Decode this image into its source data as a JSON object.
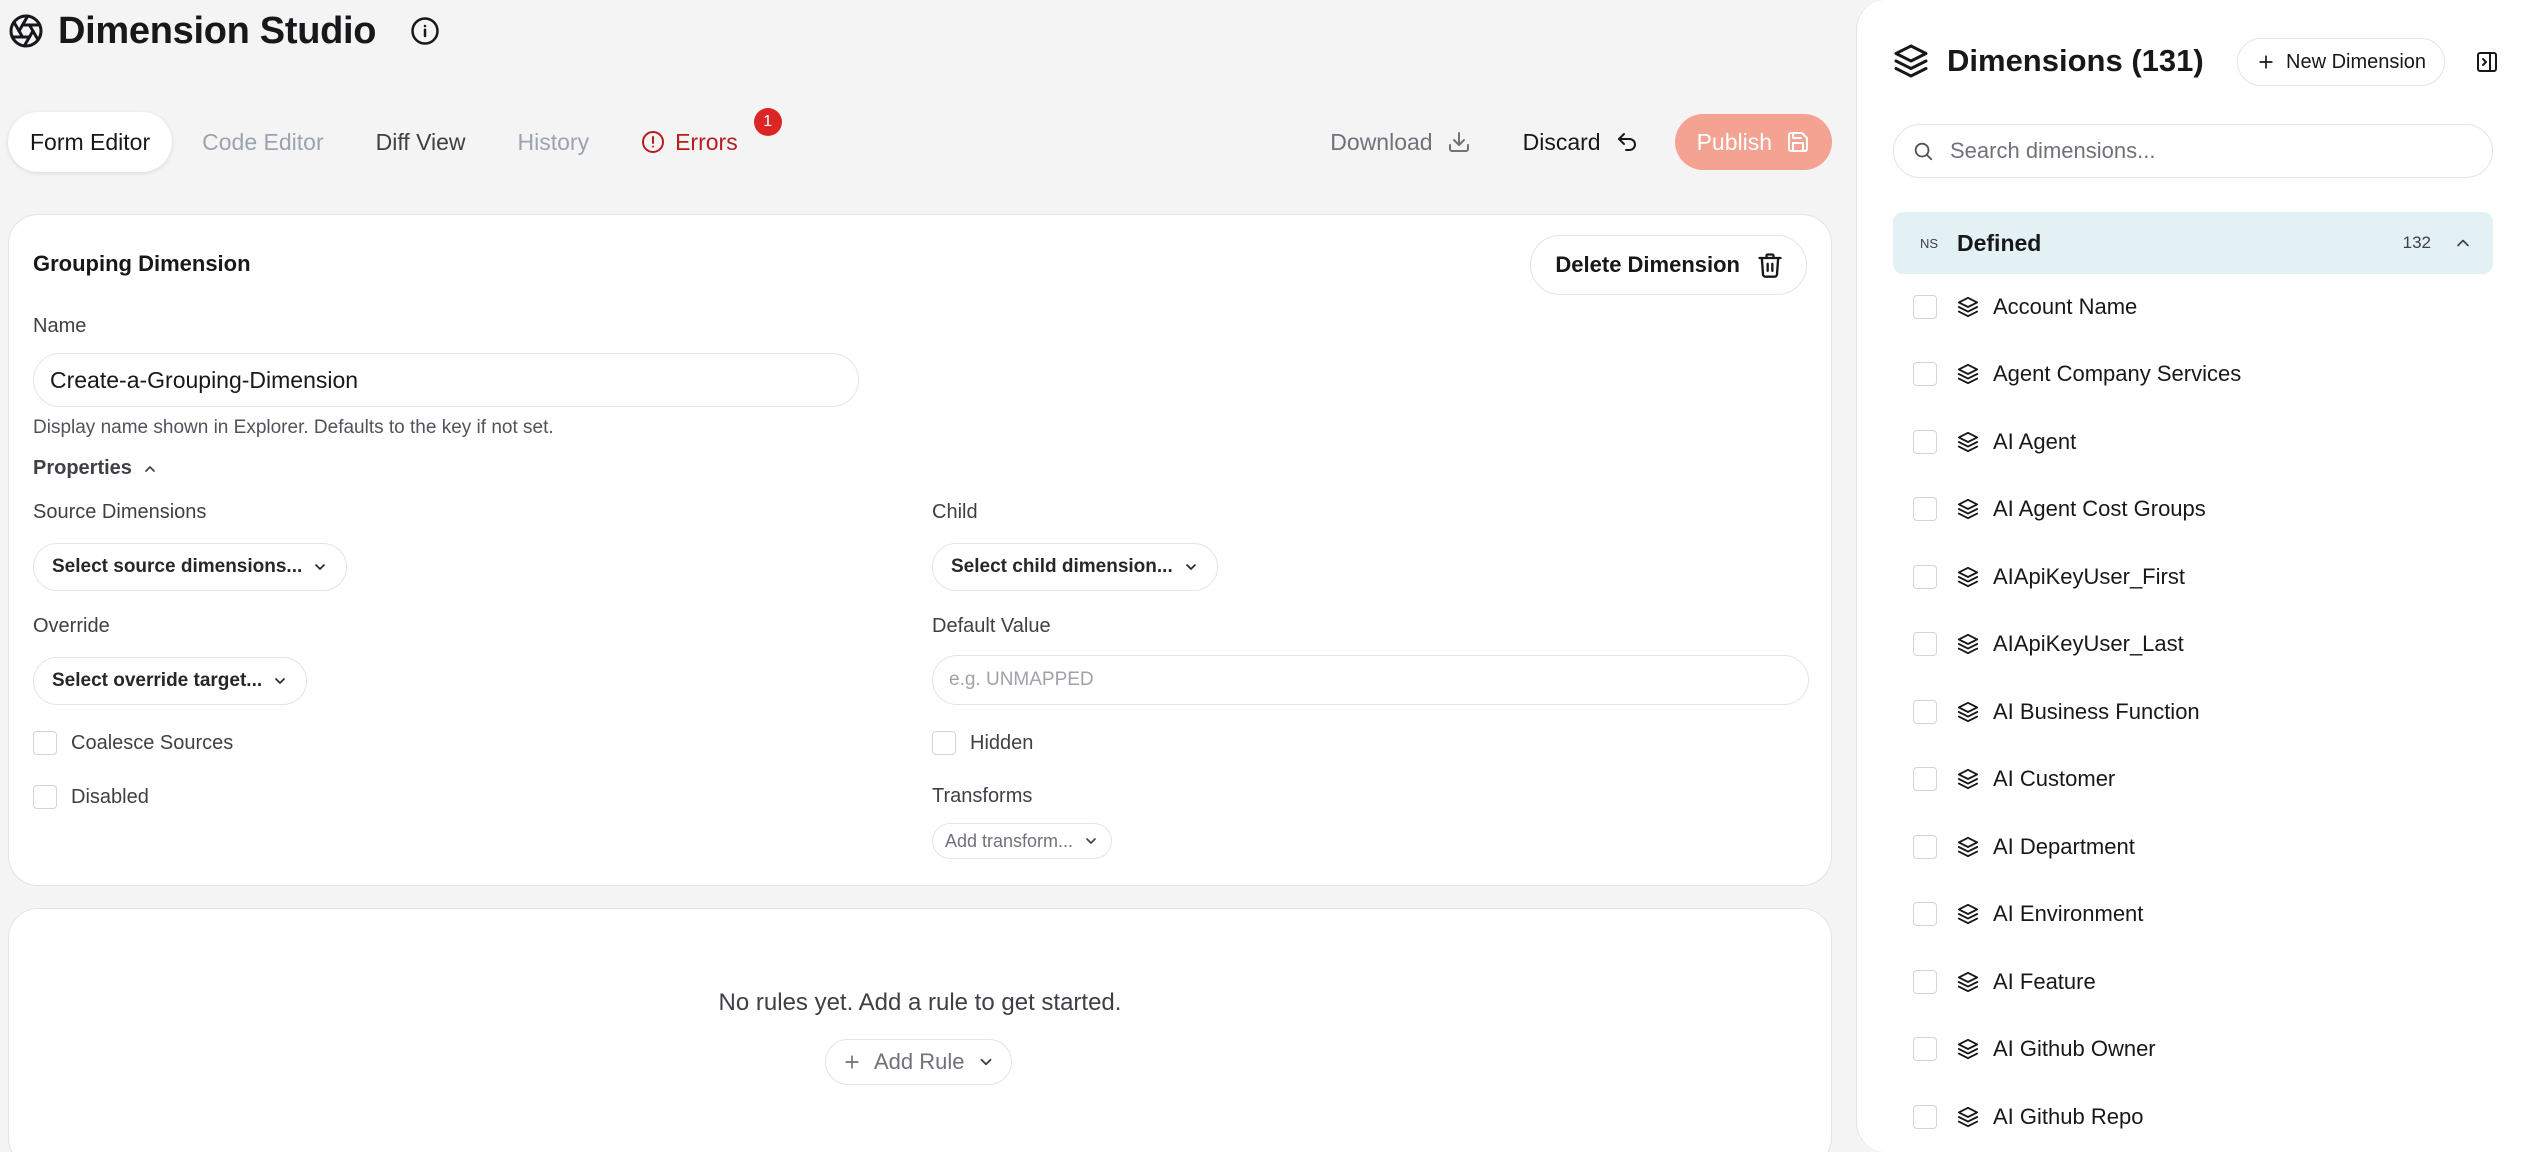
{
  "app": {
    "title": "Dimension Studio",
    "logo_icon": "aperture-icon",
    "info_icon": "info-icon"
  },
  "tabs": [
    {
      "label": "Form Editor",
      "state": "active"
    },
    {
      "label": "Code Editor",
      "state": "muted"
    },
    {
      "label": "Diff View",
      "state": "normal"
    },
    {
      "label": "History",
      "state": "muted"
    },
    {
      "label": "Errors",
      "state": "error",
      "badge": "1",
      "icon": "alert-circle-icon"
    }
  ],
  "actions": {
    "download": "Download",
    "discard": "Discard",
    "publish": "Publish",
    "publish_color": "#f4a393"
  },
  "form": {
    "card_title": "Grouping Dimension",
    "delete_label": "Delete Dimension",
    "name_label": "Name",
    "name_value": "Create-a-Grouping-Dimension",
    "name_help": "Display name shown in Explorer. Defaults to the key if not set.",
    "properties_label": "Properties",
    "source_label": "Source Dimensions",
    "source_placeholder": "Select source dimensions...",
    "child_label": "Child",
    "child_placeholder": "Select child dimension...",
    "override_label": "Override",
    "override_placeholder": "Select override target...",
    "default_label": "Default Value",
    "default_placeholder": "e.g. UNMAPPED",
    "coalesce_label": "Coalesce Sources",
    "hidden_label": "Hidden",
    "disabled_label": "Disabled",
    "transforms_label": "Transforms",
    "transforms_placeholder": "Add transform..."
  },
  "rules": {
    "empty_text": "No rules yet. Add a rule to get started.",
    "add_label": "Add Rule"
  },
  "sidebar": {
    "title": "Dimensions (131)",
    "new_label": "New Dimension",
    "search_placeholder": "Search dimensions...",
    "group": {
      "badge": "NS",
      "name": "Defined",
      "count": "132",
      "bg_color": "#e3f1f4"
    },
    "items": [
      "Account Name",
      "Agent Company Services",
      "AI Agent",
      "AI Agent Cost Groups",
      "AIApiKeyUser_First",
      "AIApiKeyUser_Last",
      "AI Business Function",
      "AI Customer",
      "AI Department",
      "AI Environment",
      "AI Feature",
      "AI Github Owner",
      "AI Github Repo"
    ]
  }
}
